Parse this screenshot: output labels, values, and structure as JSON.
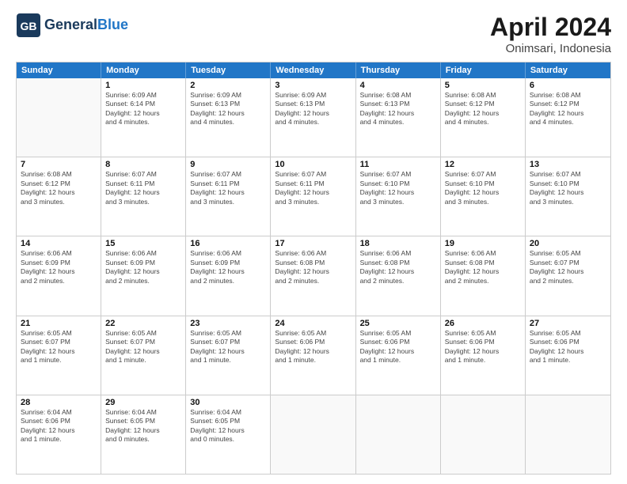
{
  "header": {
    "logo_line1": "General",
    "logo_line2": "Blue",
    "title": "April 2024",
    "subtitle": "Onimsari, Indonesia"
  },
  "weekdays": [
    "Sunday",
    "Monday",
    "Tuesday",
    "Wednesday",
    "Thursday",
    "Friday",
    "Saturday"
  ],
  "weeks": [
    [
      {
        "day": "",
        "info": ""
      },
      {
        "day": "1",
        "info": "Sunrise: 6:09 AM\nSunset: 6:14 PM\nDaylight: 12 hours\nand 4 minutes."
      },
      {
        "day": "2",
        "info": "Sunrise: 6:09 AM\nSunset: 6:13 PM\nDaylight: 12 hours\nand 4 minutes."
      },
      {
        "day": "3",
        "info": "Sunrise: 6:09 AM\nSunset: 6:13 PM\nDaylight: 12 hours\nand 4 minutes."
      },
      {
        "day": "4",
        "info": "Sunrise: 6:08 AM\nSunset: 6:13 PM\nDaylight: 12 hours\nand 4 minutes."
      },
      {
        "day": "5",
        "info": "Sunrise: 6:08 AM\nSunset: 6:12 PM\nDaylight: 12 hours\nand 4 minutes."
      },
      {
        "day": "6",
        "info": "Sunrise: 6:08 AM\nSunset: 6:12 PM\nDaylight: 12 hours\nand 4 minutes."
      }
    ],
    [
      {
        "day": "7",
        "info": "Sunrise: 6:08 AM\nSunset: 6:12 PM\nDaylight: 12 hours\nand 3 minutes."
      },
      {
        "day": "8",
        "info": "Sunrise: 6:07 AM\nSunset: 6:11 PM\nDaylight: 12 hours\nand 3 minutes."
      },
      {
        "day": "9",
        "info": "Sunrise: 6:07 AM\nSunset: 6:11 PM\nDaylight: 12 hours\nand 3 minutes."
      },
      {
        "day": "10",
        "info": "Sunrise: 6:07 AM\nSunset: 6:11 PM\nDaylight: 12 hours\nand 3 minutes."
      },
      {
        "day": "11",
        "info": "Sunrise: 6:07 AM\nSunset: 6:10 PM\nDaylight: 12 hours\nand 3 minutes."
      },
      {
        "day": "12",
        "info": "Sunrise: 6:07 AM\nSunset: 6:10 PM\nDaylight: 12 hours\nand 3 minutes."
      },
      {
        "day": "13",
        "info": "Sunrise: 6:07 AM\nSunset: 6:10 PM\nDaylight: 12 hours\nand 3 minutes."
      }
    ],
    [
      {
        "day": "14",
        "info": "Sunrise: 6:06 AM\nSunset: 6:09 PM\nDaylight: 12 hours\nand 2 minutes."
      },
      {
        "day": "15",
        "info": "Sunrise: 6:06 AM\nSunset: 6:09 PM\nDaylight: 12 hours\nand 2 minutes."
      },
      {
        "day": "16",
        "info": "Sunrise: 6:06 AM\nSunset: 6:09 PM\nDaylight: 12 hours\nand 2 minutes."
      },
      {
        "day": "17",
        "info": "Sunrise: 6:06 AM\nSunset: 6:08 PM\nDaylight: 12 hours\nand 2 minutes."
      },
      {
        "day": "18",
        "info": "Sunrise: 6:06 AM\nSunset: 6:08 PM\nDaylight: 12 hours\nand 2 minutes."
      },
      {
        "day": "19",
        "info": "Sunrise: 6:06 AM\nSunset: 6:08 PM\nDaylight: 12 hours\nand 2 minutes."
      },
      {
        "day": "20",
        "info": "Sunrise: 6:05 AM\nSunset: 6:07 PM\nDaylight: 12 hours\nand 2 minutes."
      }
    ],
    [
      {
        "day": "21",
        "info": "Sunrise: 6:05 AM\nSunset: 6:07 PM\nDaylight: 12 hours\nand 1 minute."
      },
      {
        "day": "22",
        "info": "Sunrise: 6:05 AM\nSunset: 6:07 PM\nDaylight: 12 hours\nand 1 minute."
      },
      {
        "day": "23",
        "info": "Sunrise: 6:05 AM\nSunset: 6:07 PM\nDaylight: 12 hours\nand 1 minute."
      },
      {
        "day": "24",
        "info": "Sunrise: 6:05 AM\nSunset: 6:06 PM\nDaylight: 12 hours\nand 1 minute."
      },
      {
        "day": "25",
        "info": "Sunrise: 6:05 AM\nSunset: 6:06 PM\nDaylight: 12 hours\nand 1 minute."
      },
      {
        "day": "26",
        "info": "Sunrise: 6:05 AM\nSunset: 6:06 PM\nDaylight: 12 hours\nand 1 minute."
      },
      {
        "day": "27",
        "info": "Sunrise: 6:05 AM\nSunset: 6:06 PM\nDaylight: 12 hours\nand 1 minute."
      }
    ],
    [
      {
        "day": "28",
        "info": "Sunrise: 6:04 AM\nSunset: 6:06 PM\nDaylight: 12 hours\nand 1 minute."
      },
      {
        "day": "29",
        "info": "Sunrise: 6:04 AM\nSunset: 6:05 PM\nDaylight: 12 hours\nand 0 minutes."
      },
      {
        "day": "30",
        "info": "Sunrise: 6:04 AM\nSunset: 6:05 PM\nDaylight: 12 hours\nand 0 minutes."
      },
      {
        "day": "",
        "info": ""
      },
      {
        "day": "",
        "info": ""
      },
      {
        "day": "",
        "info": ""
      },
      {
        "day": "",
        "info": ""
      }
    ]
  ]
}
